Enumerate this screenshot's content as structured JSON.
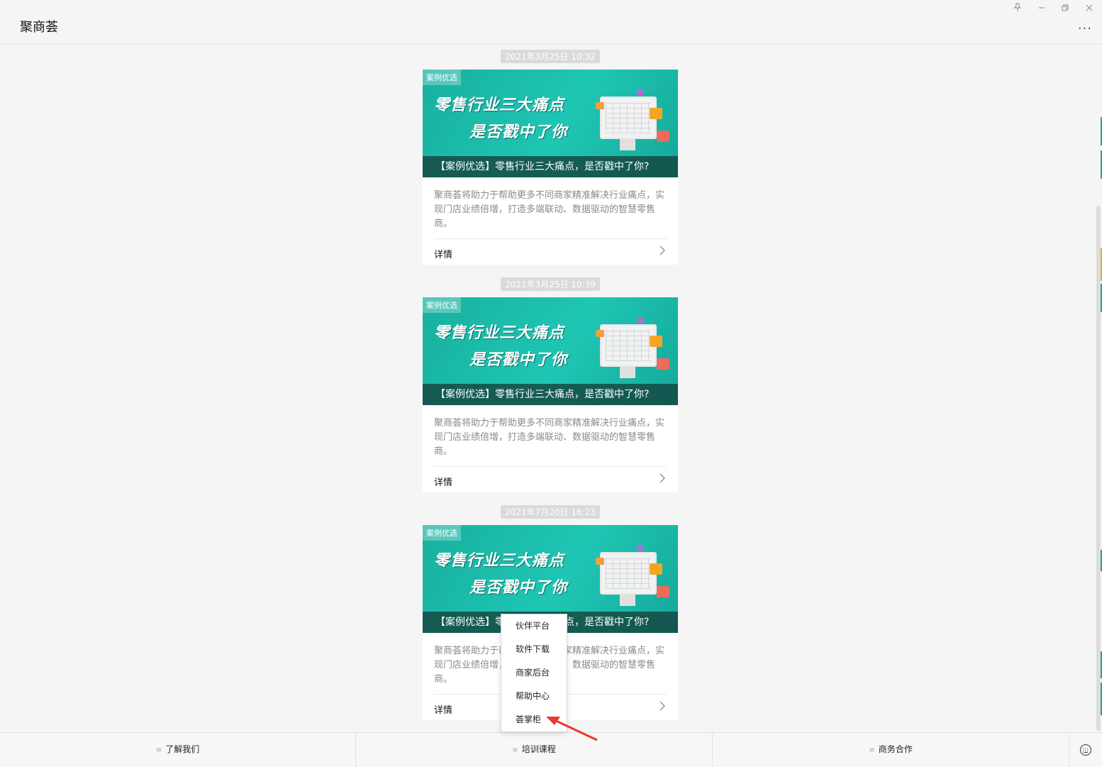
{
  "window": {
    "title": "聚商荟",
    "controls": [
      "pin-icon",
      "minimize-icon",
      "restore-icon",
      "close-icon"
    ],
    "more_label": "···"
  },
  "messages": [
    {
      "time": "2021年3月25日 10:32",
      "tag": "案例优选",
      "headline1": "零售行业三大痛点",
      "headline2": "是否戳中了你",
      "caption": "【案例优选】零售行业三大痛点，是否戳中了你?",
      "description": "聚商荟将助力于帮助更多不同商家精准解决行业痛点，实现门店业绩倍增，打造多端联动、数据驱动的智慧零售商。",
      "detail_label": "详情"
    },
    {
      "time": "2021年3月25日 10:39",
      "tag": "案例优选",
      "headline1": "零售行业三大痛点",
      "headline2": "是否戳中了你",
      "caption": "【案例优选】零售行业三大痛点，是否戳中了你?",
      "description": "聚商荟将助力于帮助更多不同商家精准解决行业痛点，实现门店业绩倍增，打造多端联动、数据驱动的智慧零售商。",
      "detail_label": "详情"
    },
    {
      "time": "2021年7月20日 16:23",
      "tag": "案例优选",
      "headline1": "零售行业三大痛点",
      "headline2": "是否戳中了你",
      "caption": "【案例优选】零售行业三大痛点，是否戳中了你?",
      "description": "聚商荟将助力于帮助更多不同商家精准解决行业痛点，实现门店业绩倍增，打造多端联动、数据驱动的智慧零售商。",
      "detail_label": "详情"
    }
  ],
  "popup_menu": {
    "items": [
      "伙伴平台",
      "软件下载",
      "商家后台",
      "帮助中心",
      "荟掌柜"
    ]
  },
  "bottom_menu": {
    "tabs": [
      "了解我们",
      "培训课程",
      "商务合作"
    ],
    "menu_icon": "≡",
    "keyboard_icon": "keyboard-icon"
  },
  "colors": {
    "banner_teal": "#1fc6b4",
    "annotation_arrow": "#e83a2e"
  }
}
